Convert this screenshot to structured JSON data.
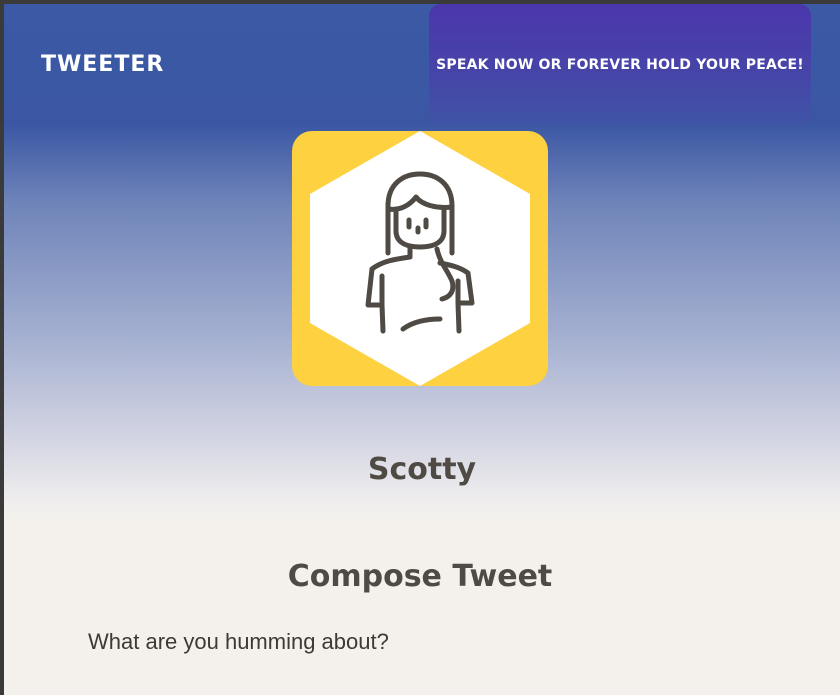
{
  "header": {
    "brand": "TWEETER",
    "slogan": "SPEAK NOW OR FOREVER HOLD YOUR PEACE!"
  },
  "profile": {
    "avatar_icon": "woman-avatar-icon",
    "username": "Scotty"
  },
  "compose": {
    "title": "Compose Tweet",
    "placeholder": "What are you humming about?",
    "value": ""
  },
  "colors": {
    "header_blue": "#3b57a3",
    "slogan_purple": "#4b37ad",
    "avatar_yellow": "#fed141",
    "text_dark": "#4f4a44",
    "page_bg": "#f4f1ec"
  }
}
